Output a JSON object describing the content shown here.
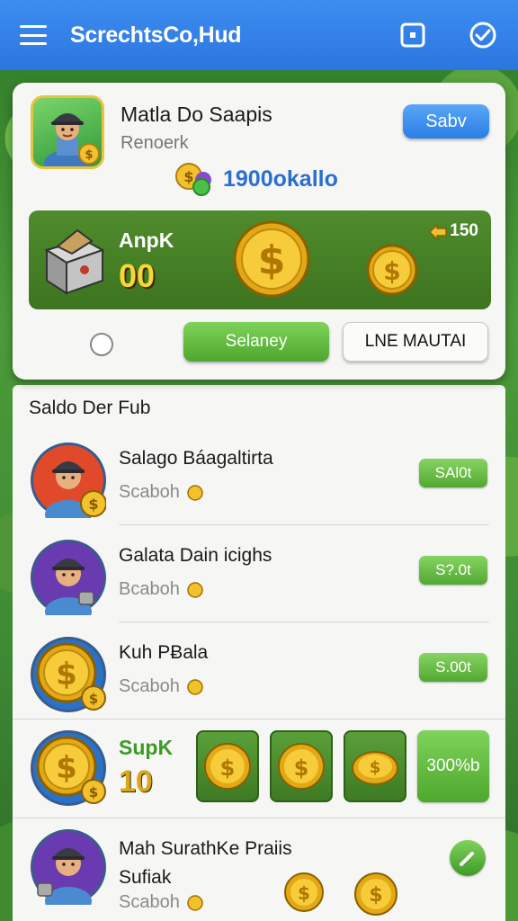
{
  "header": {
    "title": "ScrechtsCo,Hud",
    "menu_icon": "hamburger-menu-icon",
    "square_icon": "square-icon",
    "check_icon": "check-circle-icon",
    "color": "#2b7fe8"
  },
  "profile_card": {
    "name": "Matla Do Saapis",
    "subtitle": "Renoerk",
    "button_label": "Sabv",
    "balance": "1900okallo",
    "panel": {
      "label": "AnpK",
      "count": "00",
      "bonus": "150"
    },
    "primary_button": "Selaney",
    "secondary_button": "LNE MAUTAI"
  },
  "list": {
    "header": "Saldo Der Fub",
    "items": [
      {
        "title": "Salago Báagaltirta",
        "subtitle": "Scaboh",
        "button": "SAl0t",
        "avatar_bg": "#e04a2a"
      },
      {
        "title": "Galata Dain icighs",
        "subtitle": "Bcaboh",
        "button": "S?.0t",
        "avatar_bg": "#6a3ab0"
      },
      {
        "title": "Kuh PɃala",
        "subtitle": "Scaboh",
        "button": "S.00t",
        "avatar_bg": "#2a72c8"
      }
    ],
    "promo": {
      "label": "SupK",
      "count": "10",
      "percent": "300%b"
    },
    "last_item": {
      "title_line1": "Mah SurathKe Praiis",
      "title_line2": "Sufiak",
      "subtitle": "Scaboh"
    }
  },
  "colors": {
    "accent_green": "#52a832",
    "balance_blue": "#2a6fd0",
    "coin_gold": "#f2c12e"
  }
}
